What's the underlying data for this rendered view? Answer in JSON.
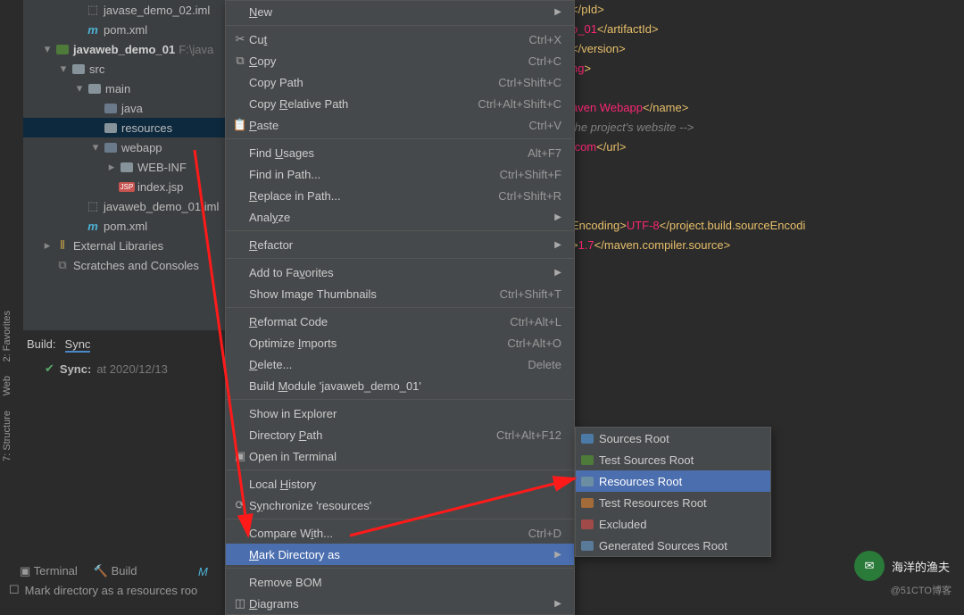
{
  "tree": {
    "items": [
      {
        "indent": 48,
        "arrow": "",
        "icon": "iml",
        "label": "javase_demo_02.iml"
      },
      {
        "indent": 48,
        "arrow": "",
        "icon": "m",
        "label": "pom.xml"
      },
      {
        "indent": 14,
        "arrow": "▾",
        "icon": "folder-m",
        "label": "javaweb_demo_01",
        "bold": true,
        "suffix": " F:\\java"
      },
      {
        "indent": 32,
        "arrow": "▾",
        "icon": "folder",
        "label": "src"
      },
      {
        "indent": 50,
        "arrow": "▾",
        "icon": "folder",
        "label": "main"
      },
      {
        "indent": 68,
        "arrow": "",
        "icon": "folder-b",
        "label": "java"
      },
      {
        "indent": 68,
        "arrow": "",
        "icon": "folder",
        "label": "resources",
        "selected": true
      },
      {
        "indent": 68,
        "arrow": "▾",
        "icon": "folder-b",
        "label": "webapp"
      },
      {
        "indent": 86,
        "arrow": "▸",
        "icon": "folder",
        "label": "WEB-INF"
      },
      {
        "indent": 86,
        "arrow": "",
        "icon": "jsp",
        "label": "index.jsp"
      },
      {
        "indent": 48,
        "arrow": "",
        "icon": "iml",
        "label": "javaweb_demo_01.iml"
      },
      {
        "indent": 48,
        "arrow": "",
        "icon": "m",
        "label": "pom.xml"
      },
      {
        "indent": 14,
        "arrow": "▸",
        "icon": "lib",
        "label": "External Libraries"
      },
      {
        "indent": 14,
        "arrow": "",
        "icon": "scratch",
        "label": "Scratches and Consoles"
      }
    ]
  },
  "build": {
    "title": "Build:",
    "tab": "Sync",
    "row": "Sync:",
    "time": "at 2020/12/13"
  },
  "status_bar": "Mark directory as a resources roo",
  "bottom_tabs": {
    "terminal": "Terminal",
    "build": "Build",
    "maven": "M"
  },
  "side_tabs": {
    "fav": "2: Favorites",
    "web": "Web",
    "struct": "7: Structure"
  },
  "editor_lines": [
    {
      "tag_close": "pId",
      "tag_end": ">"
    },
    {
      "val": "o_01",
      "tag_close": "artifactId",
      "tag_end": ">"
    },
    {
      "tag_close": "version",
      "tag_end": ">"
    },
    {
      "val": "ng",
      "tag_end": ">"
    },
    {
      "blank": true
    },
    {
      "val": "aven Webapp",
      "tag_close": "name",
      "tag_end": ">"
    },
    {
      "comment": " the project's website -->"
    },
    {
      "val": ".com",
      "tag_close": "url",
      "tag_end": ">"
    },
    {
      "blank": true
    },
    {
      "blank": true
    },
    {
      "blank": true
    },
    {
      "tag_close_pre": "Encoding",
      "tag_end_pre": ">",
      "val": "UTF-8",
      "tag_close": "project.build.sourceEncodi"
    },
    {
      "tag_end_pre": ">",
      "val": "1.7",
      "tag_close": "maven.compiler.source",
      "tag_end": ">"
    }
  ],
  "menu": {
    "items": [
      {
        "icon": "",
        "label": "New",
        "ul": 0,
        "sub": true
      },
      {
        "sep": true
      },
      {
        "icon": "✂",
        "label": "Cut",
        "ul": 2,
        "shortcut": "Ctrl+X"
      },
      {
        "icon": "⧉",
        "label": "Copy",
        "ul": 0,
        "shortcut": "Ctrl+C"
      },
      {
        "icon": "",
        "label": "Copy Path",
        "shortcut": "Ctrl+Shift+C"
      },
      {
        "icon": "",
        "label": "Copy Relative Path",
        "ul": 5,
        "shortcut": "Ctrl+Alt+Shift+C"
      },
      {
        "icon": "📋",
        "label": "Paste",
        "ul": 0,
        "shortcut": "Ctrl+V"
      },
      {
        "sep": true
      },
      {
        "icon": "",
        "label": "Find Usages",
        "ul": 5,
        "shortcut": "Alt+F7"
      },
      {
        "icon": "",
        "label": "Find in Path...",
        "shortcut": "Ctrl+Shift+F"
      },
      {
        "icon": "",
        "label": "Replace in Path...",
        "ul": 0,
        "shortcut": "Ctrl+Shift+R"
      },
      {
        "icon": "",
        "label": "Analyze",
        "ul": 4,
        "sub": true
      },
      {
        "sep": true
      },
      {
        "icon": "",
        "label": "Refactor",
        "ul": 0,
        "sub": true
      },
      {
        "sep": true
      },
      {
        "icon": "",
        "label": "Add to Favorites",
        "ul": 9,
        "sub": true
      },
      {
        "icon": "",
        "label": "Show Image Thumbnails",
        "shortcut": "Ctrl+Shift+T"
      },
      {
        "sep": true
      },
      {
        "icon": "",
        "label": "Reformat Code",
        "ul": 0,
        "shortcut": "Ctrl+Alt+L"
      },
      {
        "icon": "",
        "label": "Optimize Imports",
        "ul": 9,
        "shortcut": "Ctrl+Alt+O"
      },
      {
        "icon": "",
        "label": "Delete...",
        "ul": 0,
        "shortcut": "Delete"
      },
      {
        "icon": "",
        "label": "Build Module 'javaweb_demo_01'",
        "ul": 6
      },
      {
        "sep": true
      },
      {
        "icon": "",
        "label": "Show in Explorer"
      },
      {
        "icon": "",
        "label": "Directory Path",
        "ul": 10,
        "shortcut": "Ctrl+Alt+F12"
      },
      {
        "icon": "▣",
        "label": "Open in Terminal"
      },
      {
        "sep": true
      },
      {
        "icon": "",
        "label": "Local History",
        "ul": 6,
        "sub": true
      },
      {
        "icon": "⟳",
        "label": "Synchronize 'resources'",
        "ul": 1
      },
      {
        "sep": true
      },
      {
        "icon": "",
        "label": "Compare With...",
        "ul": 9,
        "shortcut": "Ctrl+D"
      },
      {
        "icon": "",
        "label": "Mark Directory as",
        "ul": 0,
        "sub": true,
        "selected": true
      },
      {
        "sep": true
      },
      {
        "icon": "",
        "label": "Remove BOM"
      },
      {
        "icon": "◫",
        "label": "Diagrams",
        "ul": 0,
        "sub": true
      }
    ]
  },
  "submenu": {
    "items": [
      {
        "cls": "c1",
        "label": "Sources Root"
      },
      {
        "cls": "c2",
        "label": "Test Sources Root"
      },
      {
        "cls": "c3",
        "label": "Resources Root",
        "selected": true
      },
      {
        "cls": "c4",
        "label": "Test Resources Root"
      },
      {
        "cls": "c5",
        "label": "Excluded"
      },
      {
        "cls": "c6",
        "label": "Generated Sources Root"
      }
    ]
  },
  "watermark": "海洋的渔夫",
  "credit": "@51CTO博客"
}
